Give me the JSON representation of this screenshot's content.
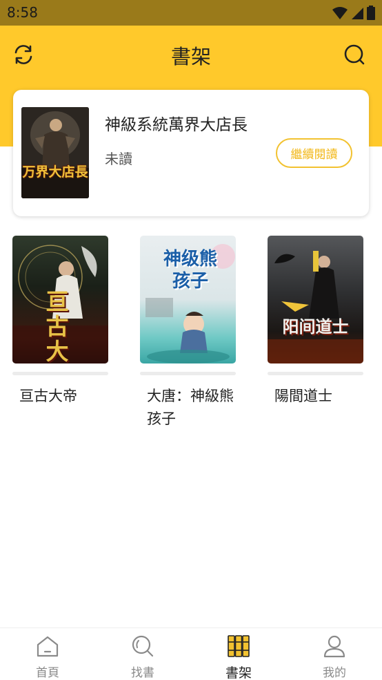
{
  "status_bar": {
    "time": "8:58"
  },
  "header": {
    "title": "書架"
  },
  "current_reading": {
    "cover_text": "万界大店長",
    "title": "神級系統萬界大店長",
    "status": "未讀",
    "continue_label": "繼續閱讀"
  },
  "books": [
    {
      "title": "亘古大帝",
      "cover_text": "亘古大帝",
      "progress": 0
    },
    {
      "title": "大唐：神級熊孩子",
      "cover_text": "神级熊孩子",
      "progress": 0
    },
    {
      "title": "陽間道士",
      "cover_text": "阳间道士",
      "progress": 0
    }
  ],
  "nav": {
    "items": [
      {
        "label": "首頁",
        "icon": "home-icon"
      },
      {
        "label": "找書",
        "icon": "search-icon"
      },
      {
        "label": "書架",
        "icon": "bookshelf-icon"
      },
      {
        "label": "我的",
        "icon": "profile-icon"
      }
    ],
    "active_index": 2
  },
  "colors": {
    "accent": "#ffc92b",
    "status_bar": "#9a7a1a",
    "button_outline": "#f2c230"
  }
}
